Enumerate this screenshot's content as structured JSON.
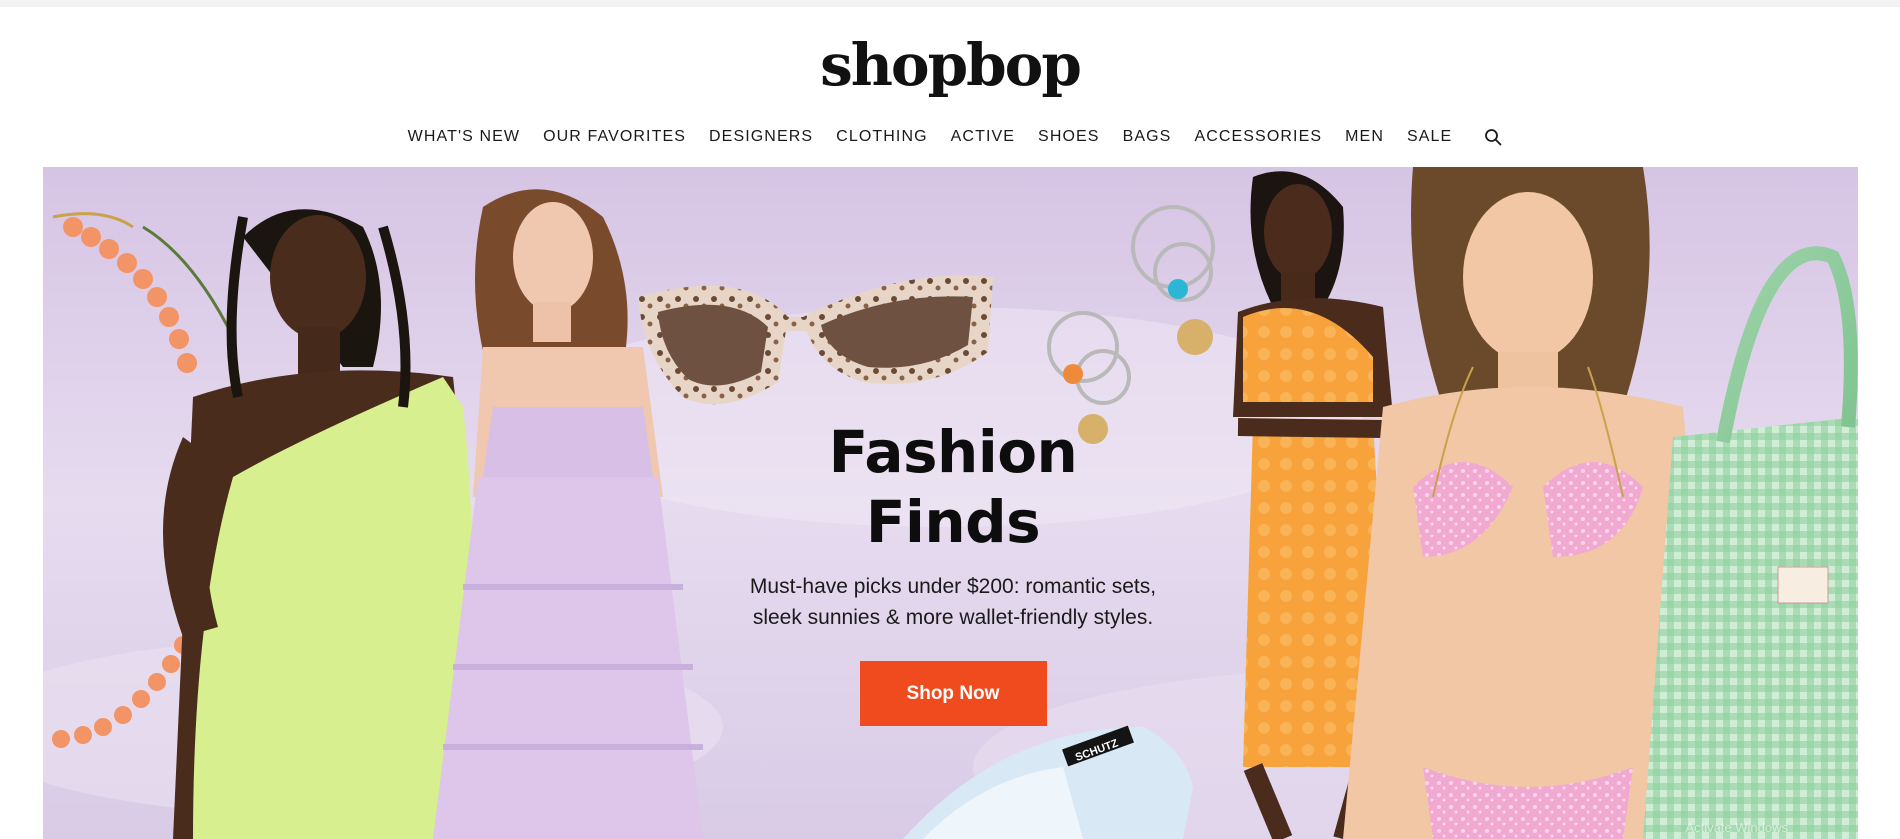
{
  "site": {
    "logo_text": "shopbop"
  },
  "nav": {
    "items": [
      {
        "label": "WHAT'S NEW"
      },
      {
        "label": "OUR FAVORITES"
      },
      {
        "label": "DESIGNERS"
      },
      {
        "label": "CLOTHING"
      },
      {
        "label": "ACTIVE"
      },
      {
        "label": "SHOES"
      },
      {
        "label": "BAGS"
      },
      {
        "label": "ACCESSORIES"
      },
      {
        "label": "MEN"
      },
      {
        "label": "SALE"
      }
    ],
    "search_icon": "search-icon"
  },
  "hero": {
    "title": "Fashion Finds",
    "subtitle": "Must-have picks under $200: romantic sets, sleek sunnies & more wallet-friendly styles.",
    "cta_label": "Shop Now",
    "cta_color": "#ef4b1f",
    "background_color": "#dccde8",
    "shoe_label": "SCHUTZ",
    "watermark": "Activate Windows"
  }
}
